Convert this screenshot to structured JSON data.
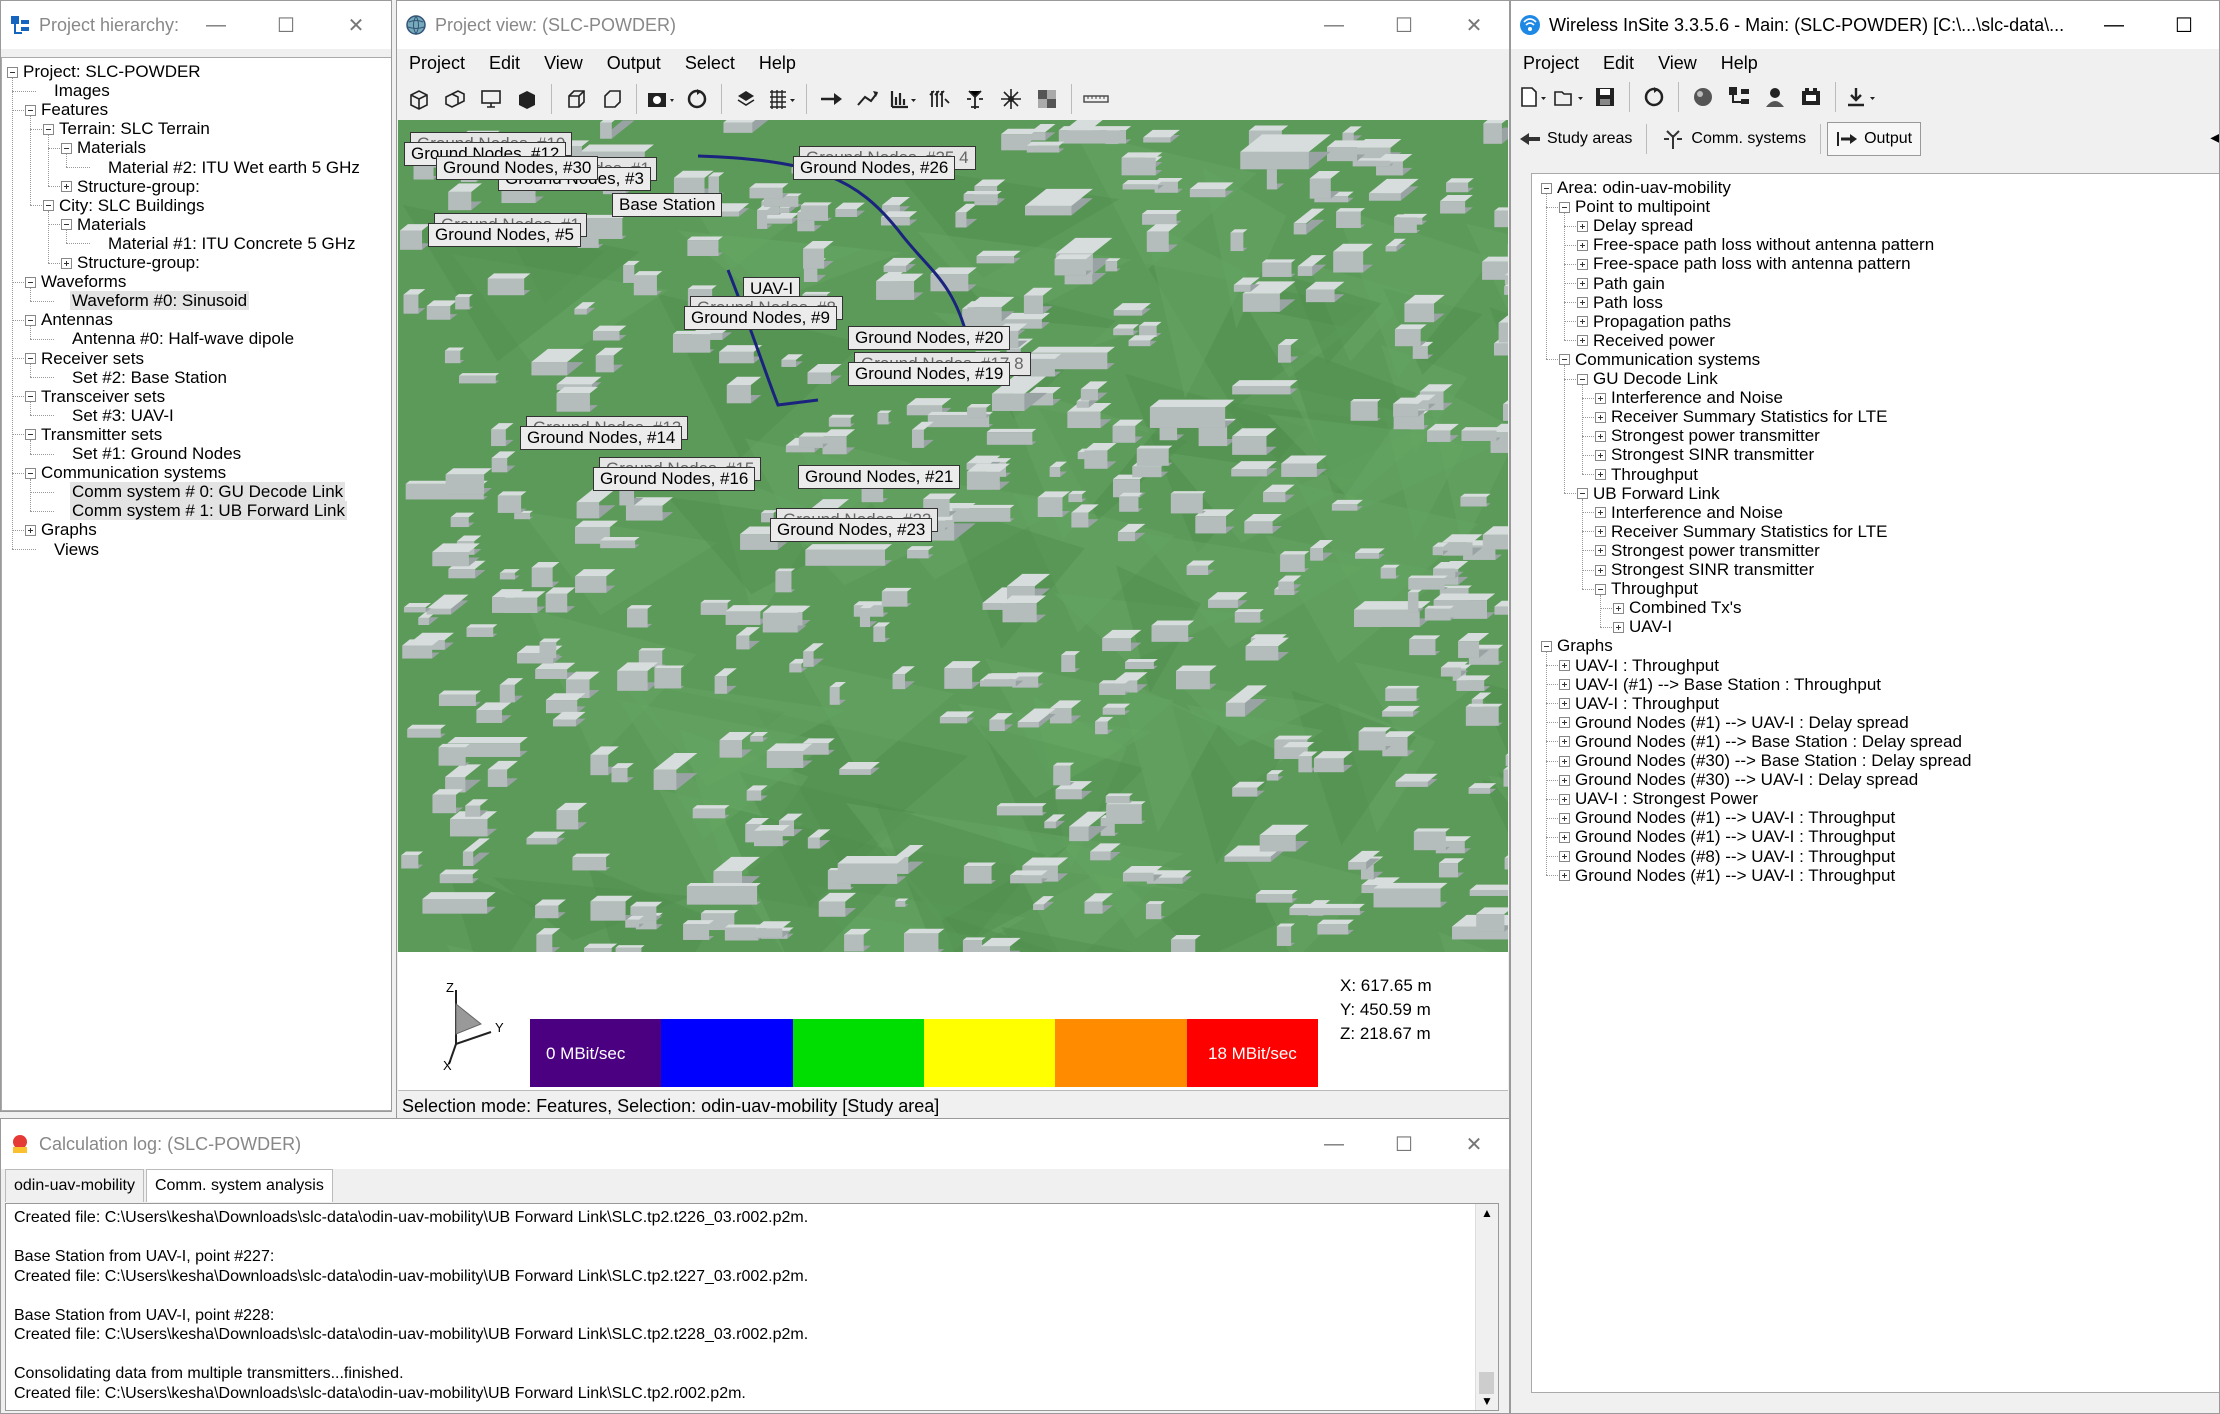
{
  "hierarchy_window": {
    "title": "Project hierarchy: (...",
    "tree": [
      {
        "label": "Project: SLC-POWDER",
        "level": 0,
        "box": "minus"
      },
      {
        "label": "Images",
        "level": 1,
        "box": "none"
      },
      {
        "label": "Features",
        "level": 1,
        "box": "minus"
      },
      {
        "label": "Terrain: SLC Terrain",
        "level": 2,
        "box": "minus"
      },
      {
        "label": "Materials",
        "level": 3,
        "box": "minus"
      },
      {
        "label": "Material #2: ITU Wet earth 5 GHz",
        "level": 4,
        "box": "none"
      },
      {
        "label": "Structure-group:",
        "level": 3,
        "box": "plus"
      },
      {
        "label": "City: SLC Buildings",
        "level": 2,
        "box": "minus"
      },
      {
        "label": "Materials",
        "level": 3,
        "box": "minus"
      },
      {
        "label": "Material #1: ITU Concrete 5 GHz",
        "level": 4,
        "box": "none"
      },
      {
        "label": "Structure-group:",
        "level": 3,
        "box": "plus"
      },
      {
        "label": "Waveforms",
        "level": 1,
        "box": "minus"
      },
      {
        "label": "Waveform #0: Sinusoid",
        "level": 2,
        "box": "none",
        "selected": true
      },
      {
        "label": "Antennas",
        "level": 1,
        "box": "minus"
      },
      {
        "label": "Antenna #0: Half-wave dipole",
        "level": 2,
        "box": "none"
      },
      {
        "label": "Receiver sets",
        "level": 1,
        "box": "minus"
      },
      {
        "label": "Set #2: Base Station",
        "level": 2,
        "box": "none"
      },
      {
        "label": "Transceiver sets",
        "level": 1,
        "box": "minus"
      },
      {
        "label": "Set #3: UAV-I",
        "level": 2,
        "box": "none"
      },
      {
        "label": "Transmitter sets",
        "level": 1,
        "box": "minus"
      },
      {
        "label": "Set #1: Ground Nodes",
        "level": 2,
        "box": "none"
      },
      {
        "label": "Communication systems",
        "level": 1,
        "box": "minus"
      },
      {
        "label": "Comm system # 0: GU Decode Link",
        "level": 2,
        "box": "none",
        "selected": true
      },
      {
        "label": "Comm system # 1: UB Forward Link",
        "level": 2,
        "box": "none",
        "selected": true
      },
      {
        "label": "Graphs",
        "level": 1,
        "box": "plus"
      },
      {
        "label": "Views",
        "level": 1,
        "box": "none"
      }
    ]
  },
  "project_view_window": {
    "title": "Project view: (SLC-POWDER)",
    "menu": [
      "Project",
      "Edit",
      "View",
      "Output",
      "Select",
      "Help"
    ],
    "labels": [
      {
        "text": "Ground Nodes, #12",
        "ghost": "Ground Nodes, #10"
      },
      {
        "text": "Ground Nodes, #3",
        "ghost": "Ground Nodes, #1"
      },
      {
        "text": "Ground Nodes, #26",
        "ghost": "Ground Nodes, #25 4"
      },
      {
        "text": "Base Station",
        "ghost": ""
      },
      {
        "text": "Ground Nodes, #5",
        "ghost": "Ground Nodes, #1"
      },
      {
        "text": "Ground Nodes, #30",
        "ghost": ""
      },
      {
        "text": "UAV-I",
        "ghost": ""
      },
      {
        "text": "Ground Nodes, #9",
        "ghost": "Ground Nodes, #8"
      },
      {
        "text": "Ground Nodes, #20",
        "ghost": ""
      },
      {
        "text": "Ground Nodes, #19",
        "ghost": "Ground Nodes, #17 8"
      },
      {
        "text": "Ground Nodes, #14",
        "ghost": "Ground Nodes, #13"
      },
      {
        "text": "Ground Nodes, #16",
        "ghost": "Ground Nodes, #15"
      },
      {
        "text": "Ground Nodes, #21",
        "ghost": ""
      },
      {
        "text": "Ground Nodes, #23",
        "ghost": "Ground Nodes, #22"
      }
    ],
    "legend": {
      "min_label": "0 MBit/sec",
      "max_label": "18 MBit/sec",
      "colors": [
        "#4b0082",
        "#0000ff",
        "#00dd00",
        "#ffff00",
        "#ff8c00",
        "#ff0000"
      ]
    },
    "coords": {
      "x": "X: 617.65 m",
      "y": "Y: 450.59 m",
      "z": "Z: 218.67 m"
    },
    "axis_labels": {
      "x": "X",
      "y": "Y",
      "z": "Z"
    },
    "status": "Selection mode: Features,  Selection: odin-uav-mobility [Study area]"
  },
  "main_window": {
    "title": "Wireless InSite 3.3.5.6 - Main: (SLC-POWDER) [C:\\...\\slc-data\\...",
    "menu": [
      "Project",
      "Edit",
      "View",
      "Help"
    ],
    "tabs": [
      "Study areas",
      "Comm. systems",
      "Output"
    ],
    "tree": [
      {
        "label": "Area: odin-uav-mobility",
        "level": 0,
        "box": "minus"
      },
      {
        "label": "Point to multipoint",
        "level": 1,
        "box": "minus"
      },
      {
        "label": "Delay spread",
        "level": 2,
        "box": "plus"
      },
      {
        "label": "Free-space path loss without antenna pattern",
        "level": 2,
        "box": "plus"
      },
      {
        "label": "Free-space path loss with antenna pattern",
        "level": 2,
        "box": "plus"
      },
      {
        "label": "Path gain",
        "level": 2,
        "box": "plus"
      },
      {
        "label": "Path loss",
        "level": 2,
        "box": "plus"
      },
      {
        "label": "Propagation paths",
        "level": 2,
        "box": "plus"
      },
      {
        "label": "Received power",
        "level": 2,
        "box": "plus"
      },
      {
        "label": "Communication systems",
        "level": 1,
        "box": "minus"
      },
      {
        "label": "GU Decode Link",
        "level": 2,
        "box": "minus"
      },
      {
        "label": "Interference and Noise",
        "level": 3,
        "box": "plus"
      },
      {
        "label": "Receiver Summary Statistics for LTE",
        "level": 3,
        "box": "plus"
      },
      {
        "label": "Strongest power transmitter",
        "level": 3,
        "box": "plus"
      },
      {
        "label": "Strongest SINR transmitter",
        "level": 3,
        "box": "plus"
      },
      {
        "label": "Throughput",
        "level": 3,
        "box": "plus"
      },
      {
        "label": "UB Forward Link",
        "level": 2,
        "box": "minus"
      },
      {
        "label": "Interference and Noise",
        "level": 3,
        "box": "plus"
      },
      {
        "label": "Receiver Summary Statistics for LTE",
        "level": 3,
        "box": "plus"
      },
      {
        "label": "Strongest power transmitter",
        "level": 3,
        "box": "plus"
      },
      {
        "label": "Strongest SINR transmitter",
        "level": 3,
        "box": "plus"
      },
      {
        "label": "Throughput",
        "level": 3,
        "box": "minus"
      },
      {
        "label": "Combined Tx's",
        "level": 4,
        "box": "plus"
      },
      {
        "label": "UAV-I",
        "level": 4,
        "box": "plus"
      },
      {
        "label": "Graphs",
        "level": 0,
        "box": "minus"
      },
      {
        "label": "UAV-I : Throughput",
        "level": 1,
        "box": "plus"
      },
      {
        "label": "UAV-I (#1) --> Base Station : Throughput",
        "level": 1,
        "box": "plus"
      },
      {
        "label": "UAV-I : Throughput",
        "level": 1,
        "box": "plus"
      },
      {
        "label": "Ground Nodes (#1) --> UAV-I : Delay spread",
        "level": 1,
        "box": "plus"
      },
      {
        "label": "Ground Nodes (#1) --> Base Station : Delay spread",
        "level": 1,
        "box": "plus"
      },
      {
        "label": "Ground Nodes (#30) --> Base Station : Delay spread",
        "level": 1,
        "box": "plus"
      },
      {
        "label": "Ground Nodes (#30) --> UAV-I : Delay spread",
        "level": 1,
        "box": "plus"
      },
      {
        "label": "UAV-I : Strongest Power",
        "level": 1,
        "box": "plus"
      },
      {
        "label": "Ground Nodes (#1) --> UAV-I : Throughput",
        "level": 1,
        "box": "plus"
      },
      {
        "label": "Ground Nodes (#1) --> UAV-I : Throughput",
        "level": 1,
        "box": "plus"
      },
      {
        "label": "Ground Nodes (#8) --> UAV-I : Throughput",
        "level": 1,
        "box": "plus"
      },
      {
        "label": "Ground Nodes (#1) --> UAV-I : Throughput",
        "level": 1,
        "box": "plus"
      }
    ]
  },
  "calc_log_window": {
    "title": "Calculation log: (SLC-POWDER)",
    "tabs": [
      "odin-uav-mobility",
      "Comm. system analysis"
    ],
    "lines": [
      "Created file: C:\\Users\\kesha\\Downloads\\slc-data\\odin-uav-mobility\\UB Forward Link\\SLC.tp2.t226_03.r002.p2m.",
      "",
      "Base Station from UAV-I, point #227:",
      "Created file: C:\\Users\\kesha\\Downloads\\slc-data\\odin-uav-mobility\\UB Forward Link\\SLC.tp2.t227_03.r002.p2m.",
      "",
      "Base Station from UAV-I, point #228:",
      "Created file: C:\\Users\\kesha\\Downloads\\slc-data\\odin-uav-mobility\\UB Forward Link\\SLC.tp2.t228_03.r002.p2m.",
      "",
      "Consolidating data from multiple transmitters...finished.",
      "Created file: C:\\Users\\kesha\\Downloads\\slc-data\\odin-uav-mobility\\UB Forward Link\\SLC.tp2.r002.p2m."
    ]
  },
  "colors": {
    "terrain": "#5b9a59",
    "building": "#d7dcdc",
    "route": "#1a237e"
  }
}
